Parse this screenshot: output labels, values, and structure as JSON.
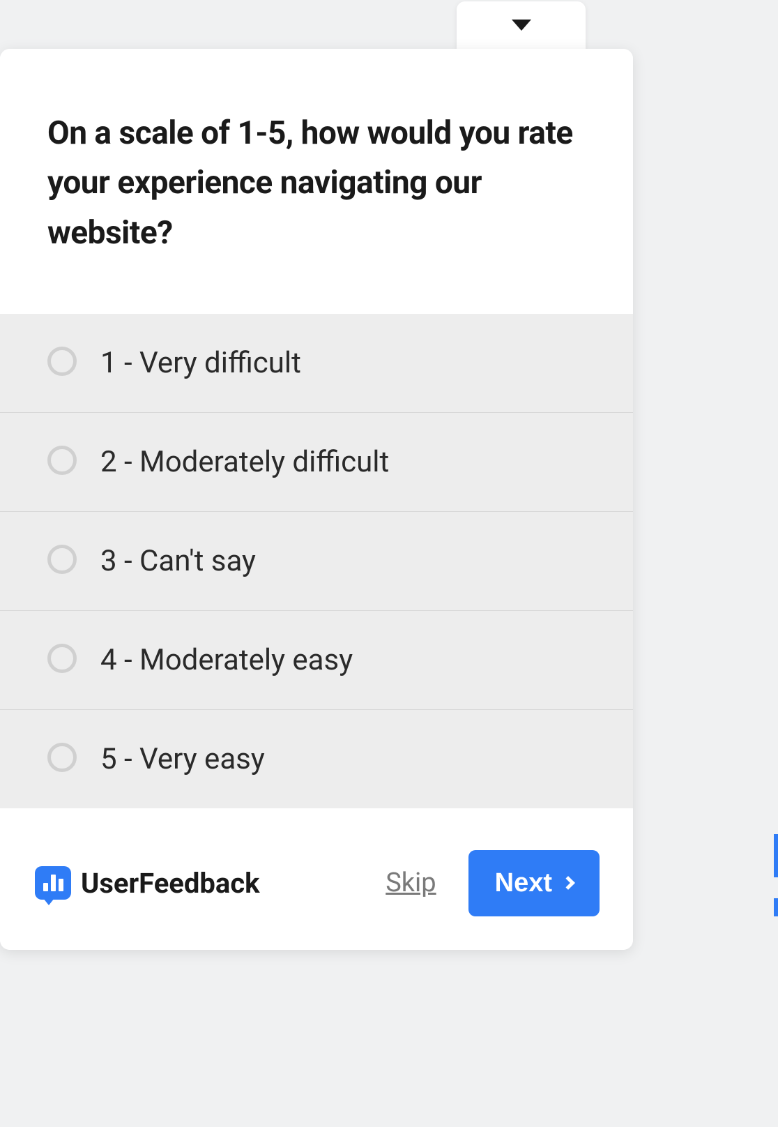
{
  "survey": {
    "question": "On a scale of 1-5, how would you rate your experience navigating our website?",
    "options": [
      {
        "label": "1 - Very difficult"
      },
      {
        "label": "2 - Moderately difficult"
      },
      {
        "label": "3 - Can't say"
      },
      {
        "label": "4 - Moderately easy"
      },
      {
        "label": "5 - Very easy"
      }
    ]
  },
  "footer": {
    "brand": "UserFeedback",
    "skip_label": "Skip",
    "next_label": "Next"
  }
}
